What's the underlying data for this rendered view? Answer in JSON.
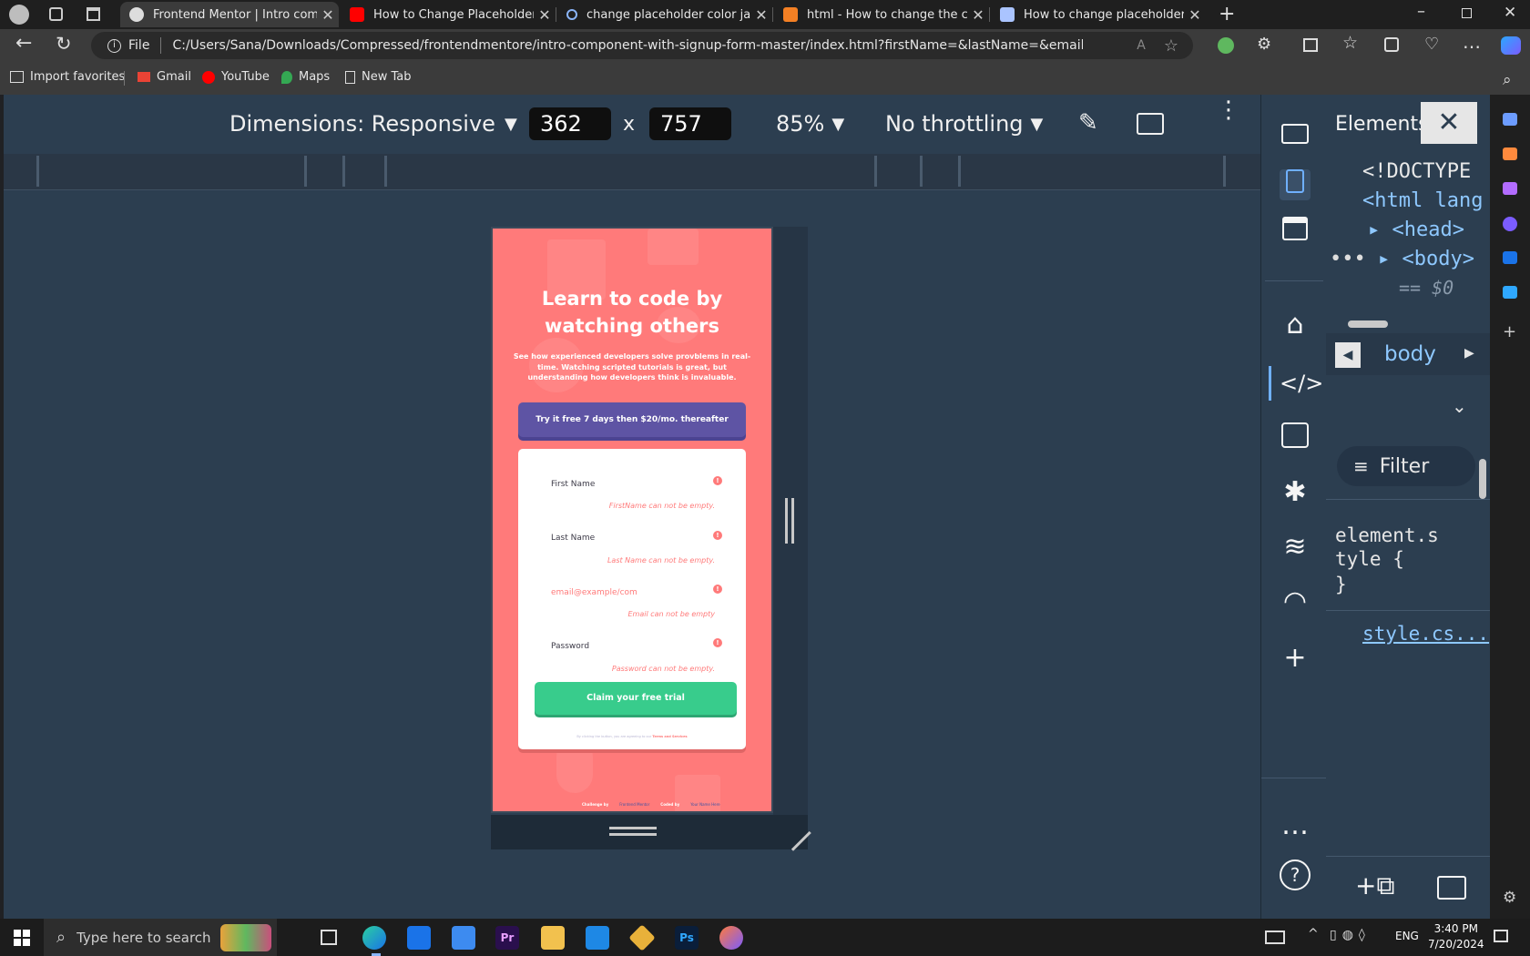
{
  "tabs": [
    {
      "title": "Frontend Mentor | Intro compon",
      "active": true
    },
    {
      "title": "How to Change Placeholder Colo"
    },
    {
      "title": "change placeholder color javascr"
    },
    {
      "title": "html - How to change the colour"
    },
    {
      "title": "How to change placeholder text"
    }
  ],
  "address": {
    "scheme": "File",
    "url": "C:/Users/Sana/Downloads/Compressed/frontendmentore/intro-component-with-signup-form-master/index.html?firstName=&lastName=&email=&password=#"
  },
  "bookmarks": [
    "Import favorites",
    "Gmail",
    "YouTube",
    "Maps",
    "New Tab"
  ],
  "devbar": {
    "dimensions": "Dimensions: Responsive",
    "width": "362",
    "times": "x",
    "height": "757",
    "zoom": "85%",
    "throttle": "No throttling"
  },
  "page": {
    "headline": "Learn to code by watching others",
    "sub": "See how experienced developers solve provblems in real-time. Watching scripted tutorials is great, but understanding how developers think is invaluable.",
    "promo": "Try it free 7 days then $20/mo. thereafter",
    "fields": [
      {
        "label": "First Name",
        "error": "FirstName can not be empty."
      },
      {
        "label": "Last Name",
        "error": "Last Name can not be empty."
      },
      {
        "label": "email@example/com",
        "error": "Email can not be empty"
      },
      {
        "label": "Password",
        "error": "Password can not be empty."
      }
    ],
    "cta": "Claim your free trial",
    "terms_pre": "By clicking the button, you are agreeing to our",
    "terms_link": "Terms and Services",
    "attrib": [
      "Challenge by",
      "Frontend Mentor",
      "Coded by",
      "Your Name Here"
    ]
  },
  "devtools": {
    "panel_title": "Elements",
    "lines": [
      "<!DOCTYPE",
      "<html lang",
      "<head>",
      "<body>",
      "== $0"
    ],
    "breadcrumb": "body",
    "filter": "Filter",
    "style_rule": [
      "element.s",
      "tyle {",
      "}"
    ],
    "style_link": "style.cs..."
  },
  "taskbar": {
    "search_placeholder": "Type here to search",
    "lang": "ENG",
    "time": "3:40 PM",
    "date": "7/20/2024"
  },
  "colors": {
    "page_bg": "#ff7a7a",
    "promo": "#5e54a4",
    "cta": "#38cc8c",
    "devtools_bg": "#2c3e50"
  }
}
